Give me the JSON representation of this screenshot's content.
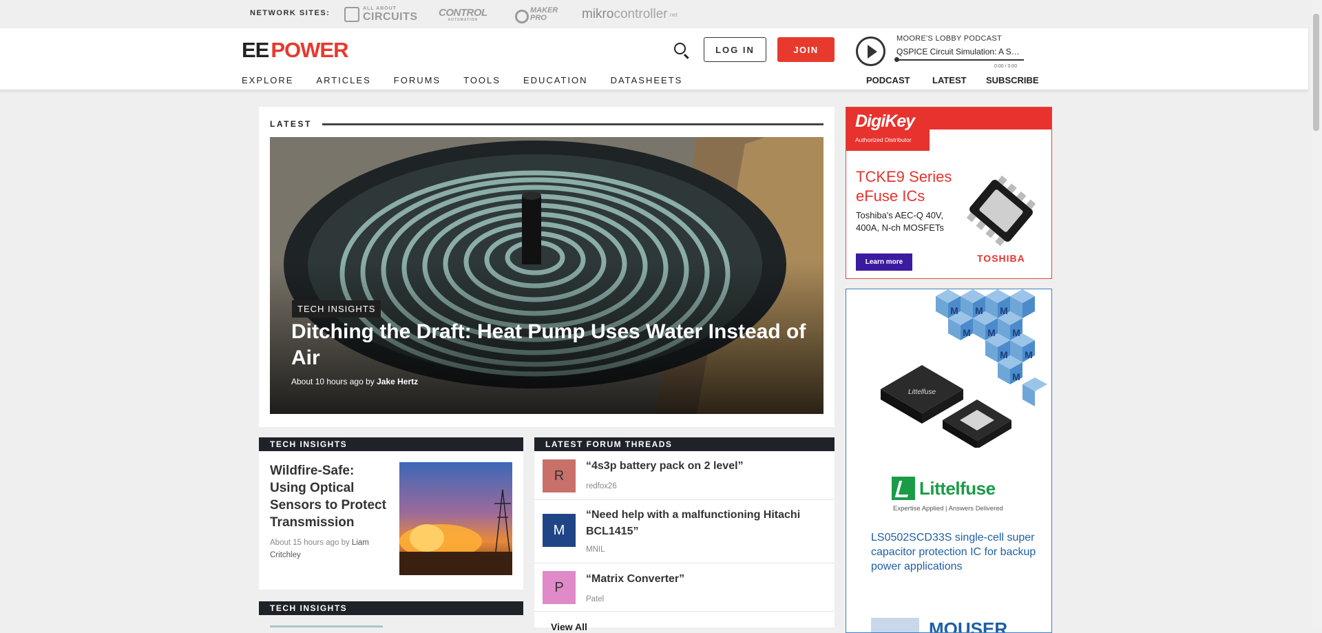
{
  "network": {
    "label": "NETWORK SITES:",
    "aac_small": "ALL ABOUT",
    "aac_big": "CIRCUITS",
    "control_big": "CONTROL",
    "control_small": "AUTOMATION",
    "maker_line1": "MAKER",
    "maker_line2": "PRO",
    "mikro_bold": "mikro",
    "mikro_rest": "controller",
    "mikro_tld": ".net"
  },
  "header": {
    "logo_ee": "EE",
    "logo_power": "POWER",
    "login_label": "LOG IN",
    "join_label": "JOIN",
    "podcast_title": "MOORE'S LOBBY PODCAST",
    "podcast_episode": "QSPICE Circuit Simulation: A Spic...",
    "podcast_time": "0:00 / 0:00"
  },
  "nav": {
    "main": [
      "EXPLORE",
      "ARTICLES",
      "FORUMS",
      "TOOLS",
      "EDUCATION",
      "DATASHEETS"
    ],
    "right": [
      "PODCAST",
      "LATEST",
      "SUBSCRIBE"
    ]
  },
  "latest": {
    "label": "LATEST",
    "tag": "TECH INSIGHTS",
    "title": "Ditching the Draft: Heat Pump Uses Water Instead of Air",
    "meta_prefix": "About 10 hours ago by ",
    "author": "Jake Hertz"
  },
  "tech": {
    "section": "TECH INSIGHTS",
    "title": "Wildfire-Safe: Using Optical Sensors to Protect Transmission",
    "meta_prefix": "About 15 hours ago by ",
    "author": "Liam Critchley",
    "section2": "TECH INSIGHTS"
  },
  "forum": {
    "section": "LATEST FORUM THREADS",
    "threads": [
      {
        "initial": "R",
        "title": "“4s3p battery pack on 2 level”",
        "user": "redfox26",
        "color": "#c9706a"
      },
      {
        "initial": "M",
        "title": "“Need help with a malfunctioning Hitachi BCL1415”",
        "user": "MNIL",
        "color": "#1f4586"
      },
      {
        "initial": "P",
        "title": "“Matrix Converter”",
        "user": "Patel",
        "color": "#e08ac9"
      }
    ],
    "view_all": "View All"
  },
  "ad_digikey": {
    "brand": "DigiKey",
    "brand_sub": "Authorized Distributor",
    "headline": "TCKE9 Series eFuse ICs",
    "desc": "Toshiba's AEC-Q 40V, 400A, N-ch MOSFETs",
    "button": "Learn more",
    "maker": "TOSHIBA"
  },
  "ad_littelfuse": {
    "brand": "Littelfuse",
    "tagline": "Expertise Applied | Answers Delivered",
    "desc": "LS0502SCD33S single-cell super capacitor protection IC for backup power applications",
    "chip_mark": "Littelfuse",
    "bottom_text": "MOUSER"
  }
}
